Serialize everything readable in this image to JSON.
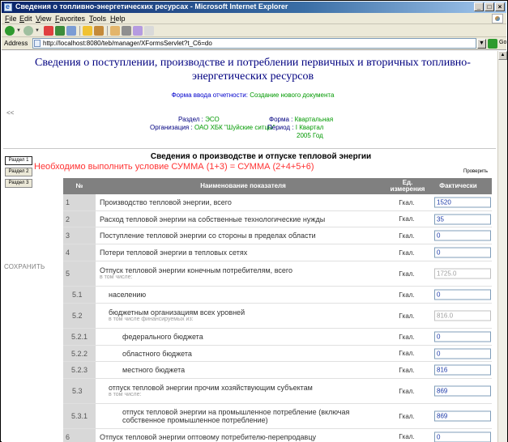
{
  "window": {
    "title": "Сведения о топливно-энергетических ресурсах - Microsoft Internet Explorer",
    "controls": [
      "_",
      "□",
      "×"
    ]
  },
  "menu": [
    "File",
    "Edit",
    "View",
    "Favorites",
    "Tools",
    "Help"
  ],
  "address": {
    "label": "Address",
    "url": "http://localhost:8080/teb/manager/XFormsServlet?t_C6=do",
    "go": "Go"
  },
  "page": {
    "title": "Сведения о поступлении, производстве и потреблении первичных и вторичных топливно-энергетических ресурсов",
    "form_mode_label": "Форма ввода отчетности:",
    "form_mode_value": "Создание нового документа",
    "back": "<<",
    "section_label": "Раздел :",
    "section_value": "ЭСО",
    "form_label": "Форма :",
    "form_value": "Квартальная",
    "org_label": "Организация :",
    "org_value": "ОАО ХБК \"Шуйские ситцы\"",
    "period_label": "Период :",
    "period_value": "I Квартал",
    "period_year": "2005 Год"
  },
  "nav": {
    "sections": [
      "Раздел 1",
      "Раздел 2",
      "Раздел 3"
    ],
    "active": 0,
    "save": "СОХРАНИТЬ"
  },
  "section": {
    "heading": "Сведения о производстве и отпуске тепловой энергии",
    "condition": "Необходимо выполнить условие СУММА (1+3) = СУММА (2+4+5+6)",
    "check": "Проверить"
  },
  "table": {
    "headers": {
      "num": "№",
      "name": "Наименование показателя",
      "unit": "Ед. измерения",
      "value": "Фактически"
    },
    "rows": [
      {
        "num": "1",
        "name": "Производство тепловой энергии, всего",
        "sub": "",
        "unit": "Гкал.",
        "value": "1520",
        "readonly": false
      },
      {
        "num": "2",
        "name": "Расход тепловой энергии на собственные технологические нужды",
        "sub": "",
        "unit": "Гкал.",
        "value": "35",
        "readonly": false
      },
      {
        "num": "3",
        "name": "Поступление тепловой энергии со стороны в пределах области",
        "sub": "",
        "unit": "Гкал.",
        "value": "0",
        "readonly": false
      },
      {
        "num": "4",
        "name": "Потери тепловой энергии в тепловых сетях",
        "sub": "",
        "unit": "Гкал.",
        "value": "0",
        "readonly": false
      },
      {
        "num": "5",
        "name": "Отпуск тепловой энергии конечным потребителям, всего",
        "sub": "в том числе:",
        "unit": "Гкал.",
        "value": "1725.0",
        "readonly": true
      },
      {
        "num": "5.1",
        "name": "населению",
        "sub": "",
        "unit": "Гкал.",
        "value": "0",
        "readonly": false
      },
      {
        "num": "5.2",
        "name": "бюджетным организациям всех уровней",
        "sub": "в том числе финансируемых из:",
        "unit": "Гкал.",
        "value": "816.0",
        "readonly": true
      },
      {
        "num": "5.2.1",
        "name": "федерального бюджета",
        "sub": "",
        "unit": "Гкал.",
        "value": "0",
        "readonly": false
      },
      {
        "num": "5.2.2",
        "name": "областного бюджета",
        "sub": "",
        "unit": "Гкал.",
        "value": "0",
        "readonly": false
      },
      {
        "num": "5.2.3",
        "name": "местного бюджета",
        "sub": "",
        "unit": "Гкал.",
        "value": "816",
        "readonly": false
      },
      {
        "num": "5.3",
        "name": "отпуск тепловой энергии прочим хозяйствующим субъектам",
        "sub": "в том числе:",
        "unit": "Гкал.",
        "value": "869",
        "readonly": false
      },
      {
        "num": "5.3.1",
        "name": "отпуск тепловой энергии на промышленное потребление (включая собственное промышленное потребление)",
        "sub": "",
        "unit": "Гкал.",
        "value": "869",
        "readonly": false
      },
      {
        "num": "6",
        "name": "Отпуск тепловой энергии оптовому потребителю-перепродавцу",
        "sub": "",
        "unit": "Гкал.",
        "value": "0",
        "readonly": false
      }
    ]
  }
}
